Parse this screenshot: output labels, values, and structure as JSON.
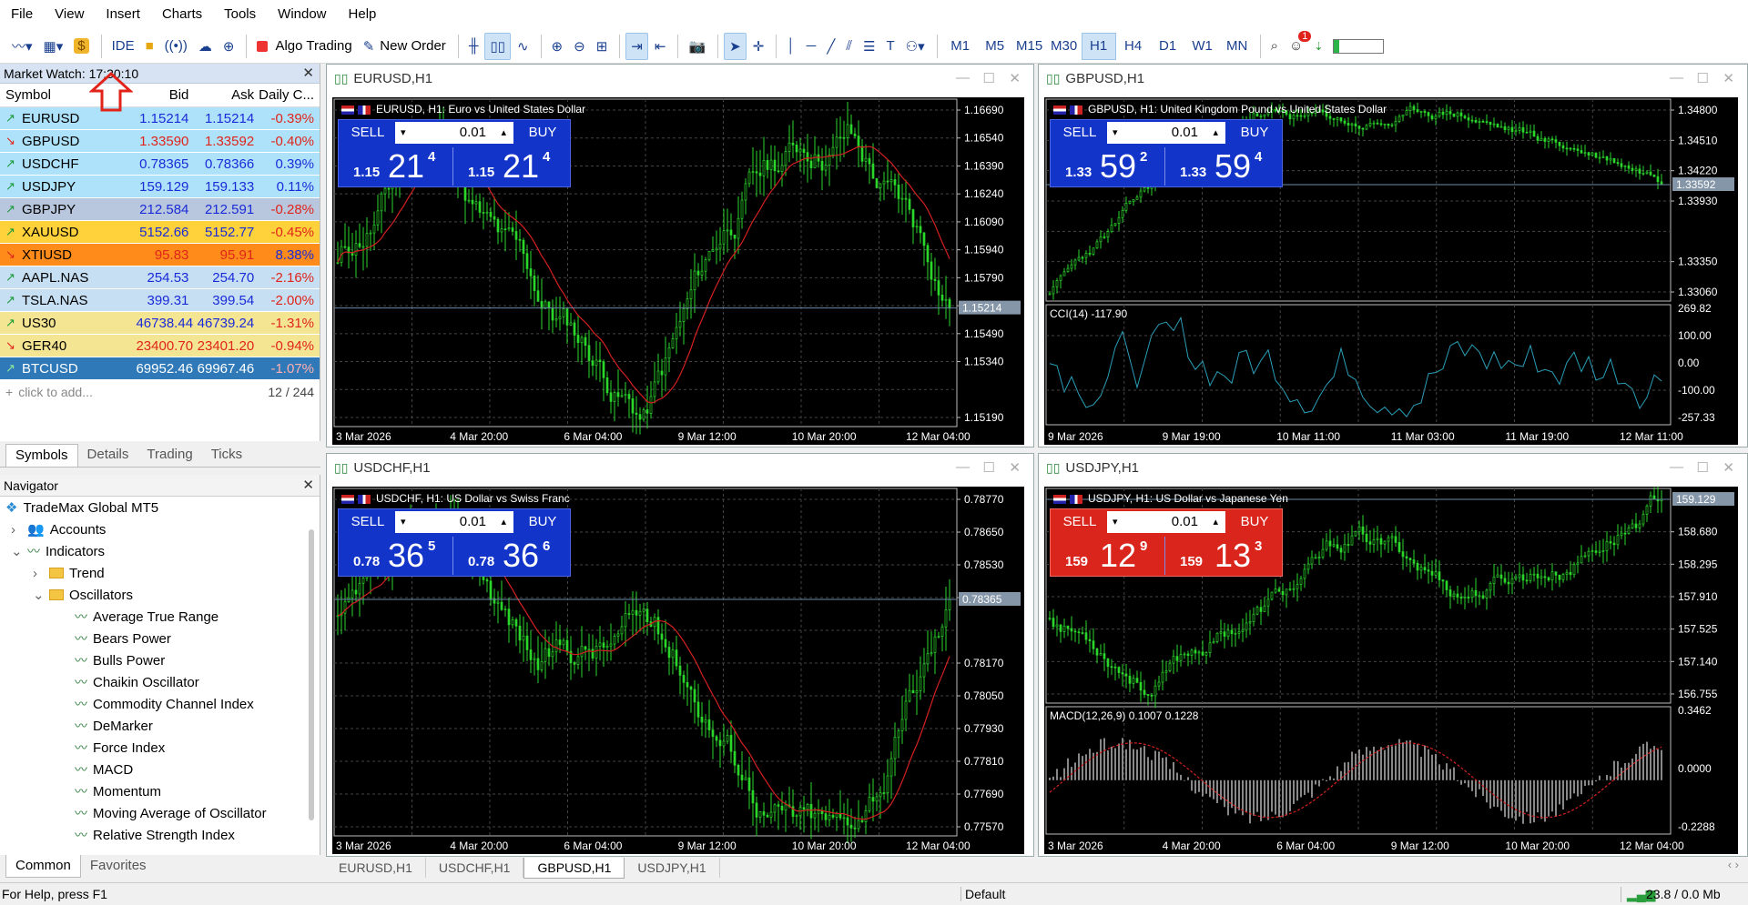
{
  "menu": [
    "File",
    "View",
    "Insert",
    "Charts",
    "Tools",
    "Window",
    "Help"
  ],
  "toolbar": {
    "ide": "IDE",
    "algo_trading": "Algo Trading",
    "new_order": "New Order",
    "timeframes": [
      "M1",
      "M5",
      "M15",
      "M30",
      "H1",
      "H4",
      "D1",
      "W1",
      "MN"
    ],
    "active_timeframe": "H1",
    "notification_count": "1"
  },
  "market_watch": {
    "title": "Market Watch: 17:30:10",
    "headers": [
      "Symbol",
      "Bid",
      "Ask",
      "Daily C..."
    ],
    "rows": [
      {
        "symbol": "EURUSD",
        "bid": "1.15214",
        "ask": "1.15214",
        "daily": "-0.39%",
        "dir": "up",
        "bg": "#aee2fb"
      },
      {
        "symbol": "GBPUSD",
        "bid": "1.33590",
        "ask": "1.33592",
        "daily": "-0.40%",
        "dir": "down",
        "bg": "#aee2fb"
      },
      {
        "symbol": "USDCHF",
        "bid": "0.78365",
        "ask": "0.78366",
        "daily": "0.39%",
        "dir": "up",
        "bg": "#aee2fb"
      },
      {
        "symbol": "USDJPY",
        "bid": "159.129",
        "ask": "159.133",
        "daily": "0.11%",
        "dir": "up",
        "bg": "#aee2fb"
      },
      {
        "symbol": "GBPJPY",
        "bid": "212.584",
        "ask": "212.591",
        "daily": "-0.28%",
        "dir": "up",
        "bg": "#b8c7dd"
      },
      {
        "symbol": "XAUUSD",
        "bid": "5152.66",
        "ask": "5152.77",
        "daily": "-0.45%",
        "dir": "up",
        "bg": "#ffd23b"
      },
      {
        "symbol": "XTIUSD",
        "bid": "95.83",
        "ask": "95.91",
        "daily": "8.38%",
        "dir": "down",
        "bg": "#ff8c1a"
      },
      {
        "symbol": "AAPL.NAS",
        "bid": "254.53",
        "ask": "254.70",
        "daily": "-2.16%",
        "dir": "up",
        "bg": "#c6dff3"
      },
      {
        "symbol": "TSLA.NAS",
        "bid": "399.31",
        "ask": "399.54",
        "daily": "-2.00%",
        "dir": "up",
        "bg": "#c6dff3"
      },
      {
        "symbol": "US30",
        "bid": "46738.44",
        "ask": "46739.24",
        "daily": "-1.31%",
        "dir": "up",
        "bg": "#f4e593"
      },
      {
        "symbol": "GER40",
        "bid": "23400.70",
        "ask": "23401.20",
        "daily": "-0.94%",
        "dir": "down",
        "bg": "#f4e593"
      },
      {
        "symbol": "BTCUSD",
        "bid": "69952.46",
        "ask": "69967.46",
        "daily": "-1.07%",
        "dir": "up",
        "bg": "#2f79b8"
      }
    ],
    "add_hint": "click to add...",
    "count": "12 / 244",
    "tabs": [
      "Symbols",
      "Details",
      "Trading",
      "Ticks"
    ]
  },
  "navigator": {
    "title": "Navigator",
    "root": "TradeMax Global MT5",
    "accounts": "Accounts",
    "indicators": "Indicators",
    "trend": "Trend",
    "oscillators": "Oscillators",
    "items": [
      "Average True Range",
      "Bears Power",
      "Bulls Power",
      "Chaikin Oscillator",
      "Commodity Channel Index",
      "DeMarker",
      "Force Index",
      "MACD",
      "Momentum",
      "Moving Average of Oscillator",
      "Relative Strength Index"
    ],
    "tabs": [
      "Common",
      "Favorites"
    ]
  },
  "charts": [
    {
      "title": "EURUSD,H1",
      "desc": "EURUSD, H1:  Euro vs United States Dollar",
      "qty": "0.01",
      "sell": {
        "a": "1.15",
        "b": "21",
        "c": "4"
      },
      "buy": {
        "a": "1.15",
        "b": "21",
        "c": "4"
      },
      "prices": [
        "1.16690",
        "1.16540",
        "1.16390",
        "1.16240",
        "1.16090",
        "1.15940",
        "1.15790",
        "1.15640",
        "1.15490",
        "1.15340",
        "1.15214",
        "1.15190"
      ],
      "last": "1.15214",
      "times": [
        "3 Mar 2026",
        "4 Mar 20:00",
        "6 Mar 04:00",
        "9 Mar 12:00",
        "10 Mar 20:00",
        "12 Mar 04:00"
      ],
      "sell_label": "SELL",
      "buy_label": "BUY"
    },
    {
      "title": "GBPUSD,H1",
      "desc": "GBPUSD, H1:  United Kingdom Pound vs United States Dollar",
      "qty": "0.01",
      "sell": {
        "a": "1.33",
        "b": "59",
        "c": "2"
      },
      "buy": {
        "a": "1.33",
        "b": "59",
        "c": "4"
      },
      "prices": [
        "1.34800",
        "1.34510",
        "1.34220",
        "1.33930",
        "1.33592",
        "1.33350",
        "1.33060"
      ],
      "last": "1.33592",
      "osc_label": "CCI(14) -117.90",
      "osc_prices": [
        "269.82",
        "100.00",
        "0.00",
        "-100.00",
        "-257.33"
      ],
      "times": [
        "9 Mar 2026",
        "9 Mar 19:00",
        "10 Mar 11:00",
        "11 Mar 03:00",
        "11 Mar 19:00",
        "12 Mar 11:00"
      ],
      "sell_label": "SELL",
      "buy_label": "BUY"
    },
    {
      "title": "USDCHF,H1",
      "desc": "USDCHF, H1:  US Dollar vs Swiss Franc",
      "qty": "0.01",
      "sell": {
        "a": "0.78",
        "b": "36",
        "c": "5"
      },
      "buy": {
        "a": "0.78",
        "b": "36",
        "c": "6"
      },
      "prices": [
        "0.78770",
        "0.78650",
        "0.78530",
        "0.78410",
        "0.78365",
        "0.78170",
        "0.78050",
        "0.77930",
        "0.77810",
        "0.77690",
        "0.77570"
      ],
      "last": "0.78365",
      "times": [
        "3 Mar 2026",
        "4 Mar 20:00",
        "6 Mar 04:00",
        "9 Mar 12:00",
        "10 Mar 20:00",
        "12 Mar 04:00"
      ],
      "sell_label": "SELL",
      "buy_label": "BUY"
    },
    {
      "title": "USDJPY,H1",
      "desc": "USDJPY, H1:  US Dollar vs Japanese Yen",
      "qty": "0.01",
      "sell": {
        "a": "159",
        "b": "12",
        "c": "9"
      },
      "buy": {
        "a": "159",
        "b": "13",
        "c": "3"
      },
      "prices": [
        "159.129",
        "158.680",
        "158.295",
        "157.910",
        "157.525",
        "157.140",
        "156.755"
      ],
      "last": "159.129",
      "osc_label": "MACD(12,26,9) 0.1007 0.1228",
      "osc_prices": [
        "0.3462",
        "0.0000",
        "-0.2288"
      ],
      "times": [
        "3 Mar 2026",
        "4 Mar 20:00",
        "6 Mar 04:00",
        "9 Mar 12:00",
        "10 Mar 20:00",
        "12 Mar 04:00"
      ],
      "sell_label": "SELL",
      "buy_label": "BUY"
    }
  ],
  "chart_tabs": [
    "EURUSD,H1",
    "USDCHF,H1",
    "GBPUSD,H1",
    "USDJPY,H1"
  ],
  "active_chart_tab": "GBPUSD,H1",
  "status": {
    "help": "For Help, press F1",
    "profile": "Default",
    "traffic": "23.8 / 0.0 Mb"
  }
}
